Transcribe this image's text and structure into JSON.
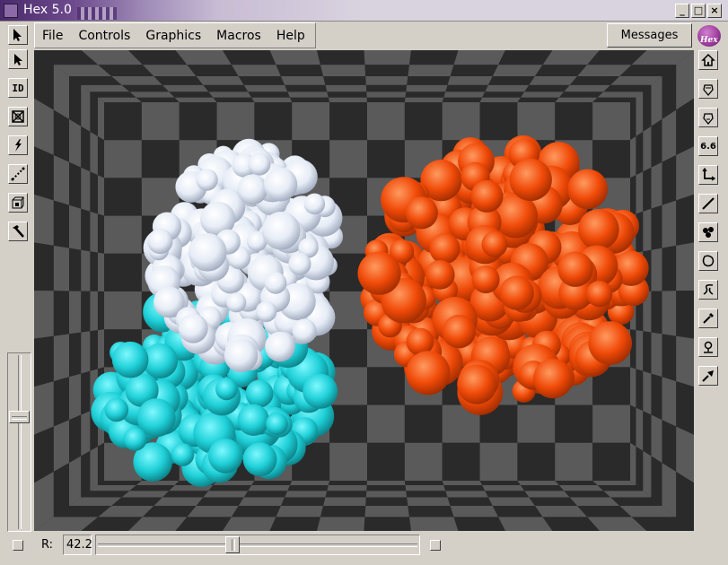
{
  "window": {
    "title": "Hex 5.0",
    "controls": {
      "minimize": "_",
      "maximize": "□",
      "close": "×"
    }
  },
  "menubar": {
    "items": [
      "File",
      "Controls",
      "Graphics",
      "Macros",
      "Help"
    ]
  },
  "messages_button": {
    "label": "Messages"
  },
  "logo": {
    "text": "Hex"
  },
  "left_toolbar": {
    "tools": [
      {
        "name": "select-arrow-icon"
      },
      {
        "name": "pointer-arrow-icon"
      },
      {
        "name": "id-label-icon",
        "glyph": "ID"
      },
      {
        "name": "cross-box-icon"
      },
      {
        "name": "lightning-icon"
      },
      {
        "name": "dotted-line-icon"
      },
      {
        "name": "cylinder-box-icon"
      },
      {
        "name": "hammer-icon"
      }
    ]
  },
  "right_toolbar": {
    "tools": [
      {
        "name": "home-icon"
      },
      {
        "name": "molecule-up-icon"
      },
      {
        "name": "molecule-down-icon"
      },
      {
        "name": "distance-label-icon",
        "glyph": "6.6"
      },
      {
        "name": "angle-axes-icon"
      },
      {
        "name": "diagonal-line-icon"
      },
      {
        "name": "cluster-icon"
      },
      {
        "name": "blob-outline-icon"
      },
      {
        "name": "dna-icon"
      },
      {
        "name": "dropper-icon"
      },
      {
        "name": "surface-pin-icon"
      },
      {
        "name": "arrows-icon"
      }
    ]
  },
  "scene": {
    "colors": {
      "checker_dark": "#2a2a2a",
      "checker_light": "#5a5a5a",
      "protein_white": "#e6ecf6",
      "protein_cyan": "#1fd0d8",
      "protein_orange": "#f04a08"
    }
  },
  "bottom": {
    "r_label": "R:",
    "r_value": "42.2",
    "slider_fraction": 0.42
  }
}
